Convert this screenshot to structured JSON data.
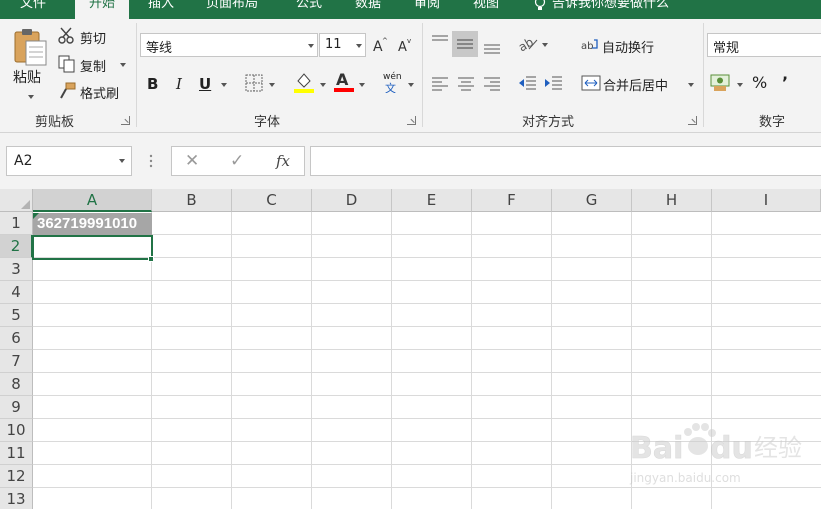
{
  "tabs": [
    "文件",
    "开始",
    "插入",
    "页面布局",
    "公式",
    "数据",
    "审阅",
    "视图",
    "告诉我你想要做什么"
  ],
  "clipboard": {
    "paste": "粘贴",
    "cut": "剪切",
    "copy": "复制",
    "format_painter": "格式刷",
    "group_label": "剪贴板"
  },
  "font": {
    "name": "等线",
    "size": "11",
    "bold": "B",
    "italic": "I",
    "underline": "U",
    "phonetic": "wén",
    "group_label": "字体",
    "highlight_color": "#ffff00",
    "font_color": "#ff0000"
  },
  "alignment": {
    "wrap_text": "自动换行",
    "merge_center": "合并后居中",
    "group_label": "对齐方式"
  },
  "number": {
    "format": "常规",
    "percent": "%",
    "comma": "’",
    "group_label": "数字"
  },
  "formula_bar": {
    "name_box": "A2",
    "cancel": "✕",
    "enter": "✓",
    "fx": "fx",
    "content": ""
  },
  "sheet": {
    "columns": [
      "A",
      "B",
      "C",
      "D",
      "E",
      "F",
      "G",
      "H",
      "I"
    ],
    "rows": [
      "1",
      "2",
      "3",
      "4",
      "5",
      "6",
      "7",
      "8",
      "9",
      "10",
      "11",
      "12",
      "13"
    ],
    "cell_A1": "362719991010",
    "active_cell": "A2"
  },
  "watermark": {
    "brand": "Bai",
    "brand2": "du",
    "jingyan": "经验",
    "url": "jingyan.baidu.com"
  },
  "colors": {
    "accent": "#217346",
    "ribbon": "#f3f3f3",
    "header": "#e6e6e6"
  }
}
